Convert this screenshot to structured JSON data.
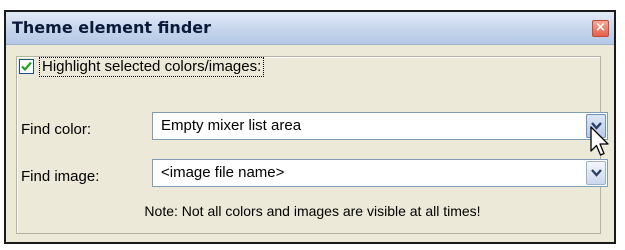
{
  "window": {
    "title": "Theme element finder",
    "close_label": "×"
  },
  "highlight": {
    "label": "Highlight selected colors/images:",
    "checked": true
  },
  "find_color": {
    "label": "Find color:",
    "value": "Empty mixer list area"
  },
  "find_image": {
    "label": "Find image:",
    "value": "<image file name>"
  },
  "note": "Note: Not all colors and images are visible at all times!",
  "icons": {
    "close": "close-icon",
    "check": "checkmark-icon",
    "dropdown": "chevron-down-icon",
    "cursor": "mouse-pointer-icon"
  },
  "colors": {
    "titlebar": "#c6d5ec",
    "dialog_bg": "#ece9d8",
    "check_mark": "#21a121",
    "close_button": "#e3604a",
    "field_border": "#7f9db9"
  }
}
